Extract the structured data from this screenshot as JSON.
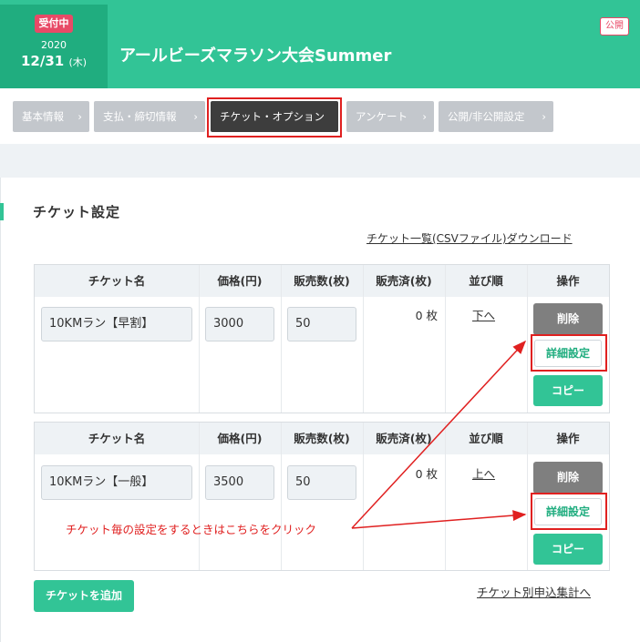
{
  "header": {
    "status_badge": "受付中",
    "year": "2020",
    "date": "12/31",
    "day_of_week": "(木)",
    "event_title": "アールビーズマラソン大会Summer",
    "public_badge": "公開"
  },
  "tabs": [
    {
      "label": "基本情報",
      "active": false
    },
    {
      "label": "支払・締切情報",
      "active": false
    },
    {
      "label": "チケット・オプション",
      "active": true
    },
    {
      "label": "アンケート",
      "active": false
    },
    {
      "label": "公開/非公開設定",
      "active": false
    }
  ],
  "chevron": "›",
  "section_title": "チケット設定",
  "csv_download_link": "チケット一覧(CSVファイル)ダウンロード",
  "table_headers": [
    "チケット名",
    "価格(円)",
    "販売数(枚)",
    "販売済(枚)",
    "並び順",
    "操作"
  ],
  "tickets": [
    {
      "name": "10KMラン【早割】",
      "price": "3000",
      "quantity": "50",
      "sold": "0 枚",
      "order_link": "下へ",
      "delete_label": "削除",
      "detail_label": "詳細設定",
      "copy_label": "コピー"
    },
    {
      "name": "10KMラン【一般】",
      "price": "3500",
      "quantity": "50",
      "sold": "0 枚",
      "order_link": "上へ",
      "delete_label": "削除",
      "detail_label": "詳細設定",
      "copy_label": "コピー"
    }
  ],
  "annotation": "チケット毎の設定をするときはこちらをクリック",
  "add_ticket_button": "チケットを追加",
  "summary_link": "チケット別申込集計へ",
  "colors": {
    "brand_green": "#32c496",
    "dark_green": "#20ad7f",
    "badge_red": "#e84a67",
    "annotation_red": "#e02020"
  }
}
